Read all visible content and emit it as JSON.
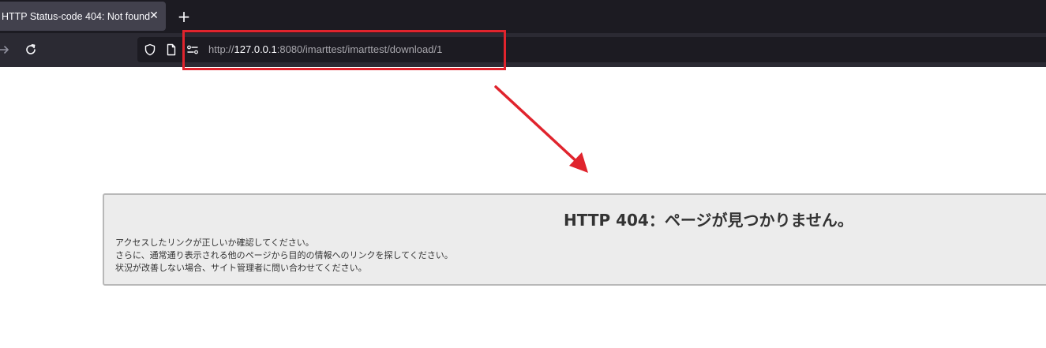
{
  "browser": {
    "tab": {
      "title": "HTTP Status-code 404: Not found"
    },
    "url": {
      "scheme": "http://",
      "host": "127.0.0.1",
      "rest": ":8080/imarttest/imarttest/download/1"
    }
  },
  "icons": {
    "tab_close": "close-icon",
    "new_tab": "plus-icon",
    "forward": "arrow-right-icon",
    "reload": "reload-icon",
    "tracking": "shield-icon",
    "page_info": "page-icon",
    "permissions": "site-permissions-icon"
  },
  "colors": {
    "annotation_red": "#e0242d",
    "tabstrip": "#1c1b22",
    "toolbar": "#2b2a33",
    "error_box_bg": "#ececec"
  },
  "page": {
    "error_title": "HTTP 404：ページが見つかりません。",
    "messages": [
      "アクセスしたリンクが正しいか確認してください。",
      "さらに、通常通り表示される他のページから目的の情報へのリンクを探してください。",
      "状況が改善しない場合、サイト管理者に問い合わせてください。"
    ]
  }
}
